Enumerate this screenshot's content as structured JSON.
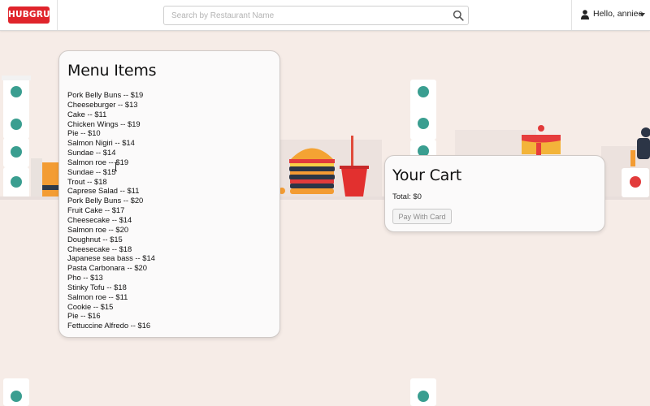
{
  "header": {
    "logo_text": "HUBGRUB",
    "search_placeholder": "Search by Restaurant Name",
    "search_value": "",
    "search_icon": "search-icon",
    "user_icon": "user-icon",
    "user_greeting": "Hello, anniee",
    "dropdown_icon": "chevron-down-icon"
  },
  "menu": {
    "title": "Menu Items",
    "items": [
      "Pork Belly Buns -- $19",
      "Cheeseburger -- $13",
      "Cake -- $11",
      "Chicken Wings -- $19",
      "Pie -- $10",
      "Salmon Nigiri -- $14",
      "Sundae -- $14",
      "Salmon roe -- $19",
      "Sundae -- $15",
      "Trout -- $18",
      "Caprese Salad -- $11",
      "Pork Belly Buns -- $20",
      "Fruit Cake -- $17",
      "Cheesecake -- $14",
      "Salmon roe -- $20",
      "Doughnut -- $15",
      "Cheesecake -- $18",
      "Japanese sea bass -- $14",
      "Pasta Carbonara -- $20",
      "Pho -- $13",
      "Stinky Tofu -- $18",
      "Salmon roe -- $11",
      "Cookie -- $15",
      "Pie -- $16",
      "Fettuccine Alfredo -- $16"
    ]
  },
  "cart": {
    "title": "Your Cart",
    "total": "Total: $0",
    "pay_button_label": "Pay With Card"
  },
  "colors": {
    "brand_red": "#e0242b",
    "page_background": "#f6ece7",
    "cup_accent": "#3a9e90"
  }
}
